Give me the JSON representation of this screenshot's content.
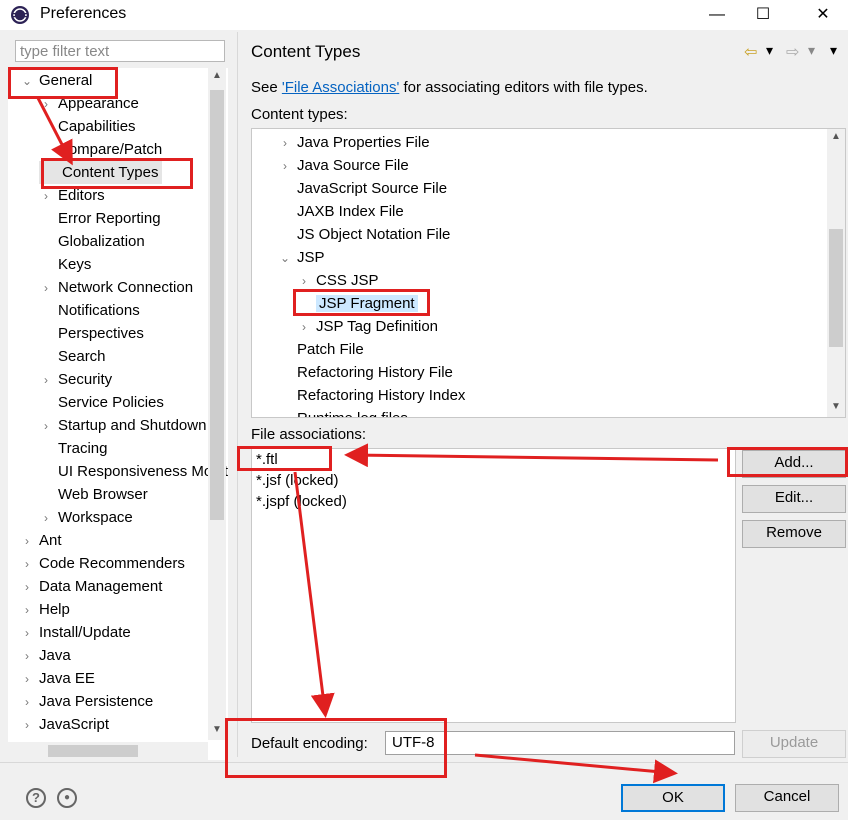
{
  "window": {
    "title": "Preferences",
    "minimize": "—",
    "maximize": "☐",
    "close": "✕"
  },
  "filter": {
    "placeholder": "type filter text"
  },
  "tree": {
    "rows": [
      {
        "label": "General",
        "level": 0,
        "chev": "⌄"
      },
      {
        "label": "Appearance",
        "level": 1,
        "chev": "›"
      },
      {
        "label": "Capabilities",
        "level": 1,
        "chev": ""
      },
      {
        "label": "Compare/Patch",
        "level": 1,
        "chev": ""
      },
      {
        "label": "Content Types",
        "level": 1,
        "chev": ""
      },
      {
        "label": "Editors",
        "level": 1,
        "chev": "›"
      },
      {
        "label": "Error Reporting",
        "level": 1,
        "chev": ""
      },
      {
        "label": "Globalization",
        "level": 1,
        "chev": ""
      },
      {
        "label": "Keys",
        "level": 1,
        "chev": ""
      },
      {
        "label": "Network Connection",
        "level": 1,
        "chev": "›"
      },
      {
        "label": "Notifications",
        "level": 1,
        "chev": ""
      },
      {
        "label": "Perspectives",
        "level": 1,
        "chev": ""
      },
      {
        "label": "Search",
        "level": 1,
        "chev": ""
      },
      {
        "label": "Security",
        "level": 1,
        "chev": "›"
      },
      {
        "label": "Service Policies",
        "level": 1,
        "chev": ""
      },
      {
        "label": "Startup and Shutdown",
        "level": 1,
        "chev": "›"
      },
      {
        "label": "Tracing",
        "level": 1,
        "chev": ""
      },
      {
        "label": "UI Responsiveness Monitoring",
        "level": 1,
        "chev": ""
      },
      {
        "label": "Web Browser",
        "level": 1,
        "chev": ""
      },
      {
        "label": "Workspace",
        "level": 1,
        "chev": "›"
      },
      {
        "label": "Ant",
        "level": 0,
        "chev": "›"
      },
      {
        "label": "Code Recommenders",
        "level": 0,
        "chev": "›"
      },
      {
        "label": "Data Management",
        "level": 0,
        "chev": "›"
      },
      {
        "label": "Help",
        "level": 0,
        "chev": "›"
      },
      {
        "label": "Install/Update",
        "level": 0,
        "chev": "›"
      },
      {
        "label": "Java",
        "level": 0,
        "chev": "›"
      },
      {
        "label": "Java EE",
        "level": 0,
        "chev": "›"
      },
      {
        "label": "Java Persistence",
        "level": 0,
        "chev": "›"
      },
      {
        "label": "JavaScript",
        "level": 0,
        "chev": "›"
      }
    ],
    "selected": "Content Types"
  },
  "page": {
    "title": "Content Types",
    "see_prefix": "See ",
    "see_link": "'File Associations'",
    "see_suffix": " for associating editors with file types.",
    "content_types_label": "Content types:",
    "file_assoc_label": "File associations:",
    "encoding_label": "Default encoding:",
    "encoding_value": "UTF-8"
  },
  "content_types": [
    {
      "label": "Java Properties File",
      "level": 0,
      "chev": "›"
    },
    {
      "label": "Java Source File",
      "level": 0,
      "chev": "›"
    },
    {
      "label": "JavaScript Source File",
      "level": 0,
      "chev": ""
    },
    {
      "label": "JAXB Index File",
      "level": 0,
      "chev": ""
    },
    {
      "label": "JS Object Notation File",
      "level": 0,
      "chev": ""
    },
    {
      "label": "JSP",
      "level": 0,
      "chev": "⌄"
    },
    {
      "label": "CSS JSP",
      "level": 1,
      "chev": "›"
    },
    {
      "label": "JSP Fragment",
      "level": 1,
      "chev": ""
    },
    {
      "label": "JSP Tag Definition",
      "level": 1,
      "chev": "›"
    },
    {
      "label": "Patch File",
      "level": 0,
      "chev": ""
    },
    {
      "label": "Refactoring History File",
      "level": 0,
      "chev": ""
    },
    {
      "label": "Refactoring History Index",
      "level": 0,
      "chev": ""
    },
    {
      "label": "Runtime log files",
      "level": 0,
      "chev": ""
    }
  ],
  "file_associations": [
    "*.ftl",
    "*.jsf (locked)",
    "*.jspf (locked)"
  ],
  "buttons": {
    "add": "Add...",
    "edit": "Edit...",
    "remove": "Remove",
    "update": "Update",
    "ok": "OK",
    "cancel": "Cancel"
  },
  "icons": {
    "help": "?",
    "record": "●",
    "up": "▲",
    "down": "▼",
    "back": "⇦",
    "forward": "⇨",
    "menu": "▾"
  },
  "colors": {
    "annotation_red": "#e02020",
    "selection": "#cce8ff",
    "link": "#0563c1"
  }
}
